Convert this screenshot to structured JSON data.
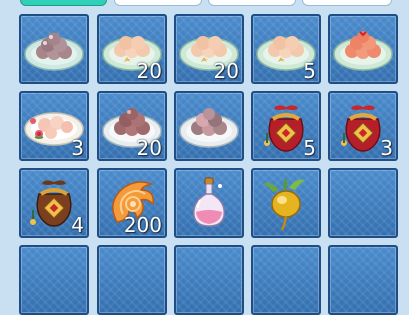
{
  "inventory": {
    "slots": [
      {
        "item": "plate-of-dark-pink-dumplings-icon",
        "count": ""
      },
      {
        "item": "plate-of-peach-dumplings-icon",
        "count": "20"
      },
      {
        "item": "plate-of-peach-dumplings-icon",
        "count": "20"
      },
      {
        "item": "plate-of-peach-dumplings-icon",
        "count": "5"
      },
      {
        "item": "plate-of-red-dumplings-icon",
        "count": ""
      },
      {
        "item": "plate-of-pink-dumplings-with-roses-icon",
        "count": "3"
      },
      {
        "item": "plate-of-red-bean-dumplings-icon",
        "count": "20"
      },
      {
        "item": "plate-of-mixed-dumplings-icon",
        "count": ""
      },
      {
        "item": "red-lucky-pouch-icon",
        "count": "5"
      },
      {
        "item": "red-lucky-pouch-icon",
        "count": "3"
      },
      {
        "item": "brown-lucky-pouch-icon",
        "count": "4"
      },
      {
        "item": "orange-spiral-shell-icon",
        "count": "200"
      },
      {
        "item": "pink-potion-bottle-icon",
        "count": ""
      },
      {
        "item": "golden-radish-icon",
        "count": ""
      }
    ]
  },
  "colors": {
    "slot_bg": "#3f7fc0",
    "slot_border": "#1f4d86",
    "count_text": "#ffffff",
    "active_tab": "#2fd0b8"
  }
}
